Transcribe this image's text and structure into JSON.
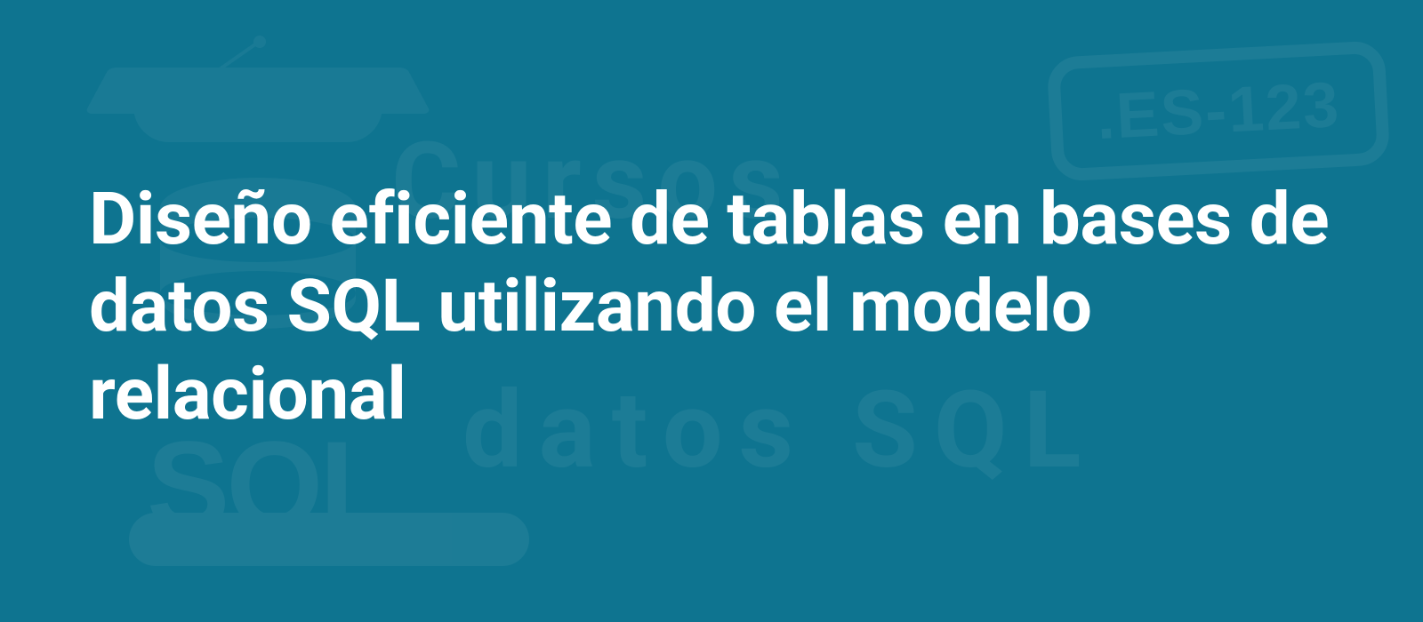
{
  "headline": "Diseño eficiente de tablas en bases de datos SQL utilizando el modelo relacional",
  "watermarks": {
    "line1": "Cursos",
    "line2": "datos SQL",
    "badge": ".ES-123",
    "sql": "SQL"
  }
}
